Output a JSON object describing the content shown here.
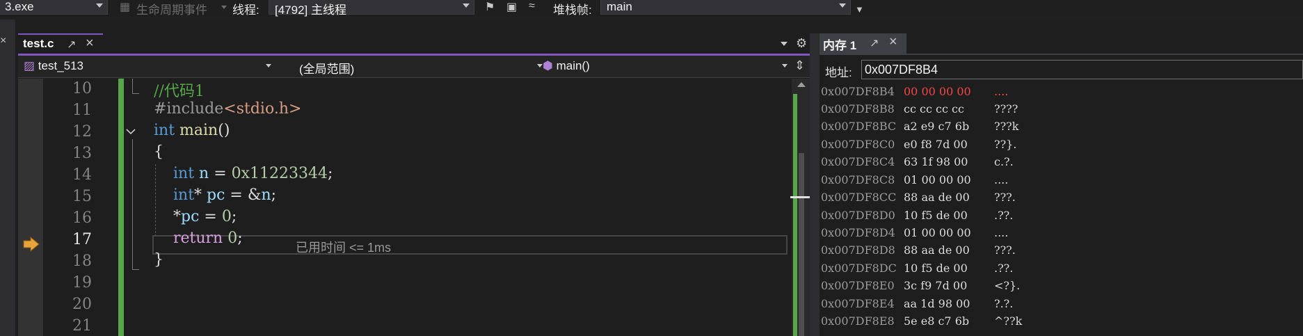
{
  "toolbar": {
    "process_value": "3.exe",
    "lifecycle_label": "生命周期事件",
    "thread_label": "线程:",
    "thread_value": "[4792] 主线程",
    "stackframe_label": "堆栈帧:",
    "stackframe_value": "main"
  },
  "editor": {
    "tab_title": "test.c",
    "nav": {
      "project": "test_513",
      "scope": "(全局范围)",
      "function": "main()"
    },
    "line_numbers": [
      "10",
      "11",
      "12",
      "13",
      "14",
      "15",
      "16",
      "17",
      "18",
      "19",
      "20",
      "21"
    ],
    "current_line": "17",
    "code": {
      "l10": "//代码1",
      "l11_pp": "#include",
      "l11_hdr": "<stdio.h>",
      "l12_kw": "int",
      "l12_fn": "main",
      "l12_paren": "()",
      "l13": "{",
      "l14_kw": "int",
      "l14_var": "n",
      "l14_op": " = ",
      "l14_num": "0x11223344",
      "l14_end": ";",
      "l15_kw": "int",
      "l15_star": "*",
      "l15_var": "pc",
      "l15_op": " = &",
      "l15_var2": "n",
      "l15_end": ";",
      "l16_star": "*",
      "l16_var": "pc",
      "l16_op": " = ",
      "l16_num": "0",
      "l16_end": ";",
      "l17_kw": "return",
      "l17_num": "0",
      "l17_end": ";",
      "l18": "}"
    },
    "perf_tip": "已用时间 <= 1ms"
  },
  "memory": {
    "tab_title": "内存 1",
    "address_label": "地址:",
    "address_value": "0x007DF8B4",
    "rows": [
      {
        "addr": "0x007DF8B4",
        "hex": "00 00 00 00",
        "ascii": "....",
        "changed": true
      },
      {
        "addr": "0x007DF8B8",
        "hex": "cc cc cc cc",
        "ascii": "????"
      },
      {
        "addr": "0x007DF8BC",
        "hex": "a2 e9 c7 6b",
        "ascii": "???k"
      },
      {
        "addr": "0x007DF8C0",
        "hex": "e0 f8 7d 00",
        "ascii": "??}."
      },
      {
        "addr": "0x007DF8C4",
        "hex": "63 1f 98 00",
        "ascii": "c.?."
      },
      {
        "addr": "0x007DF8C8",
        "hex": "01 00 00 00",
        "ascii": "...."
      },
      {
        "addr": "0x007DF8CC",
        "hex": "88 aa de 00",
        "ascii": "???."
      },
      {
        "addr": "0x007DF8D0",
        "hex": "10 f5 de 00",
        "ascii": ".??."
      },
      {
        "addr": "0x007DF8D4",
        "hex": "01 00 00 00",
        "ascii": "...."
      },
      {
        "addr": "0x007DF8D8",
        "hex": "88 aa de 00",
        "ascii": "???."
      },
      {
        "addr": "0x007DF8DC",
        "hex": "10 f5 de 00",
        "ascii": ".??."
      },
      {
        "addr": "0x007DF8E0",
        "hex": "3c f9 7d 00",
        "ascii": "<?}."
      },
      {
        "addr": "0x007DF8E4",
        "hex": "aa 1d 98 00",
        "ascii": "?.?."
      },
      {
        "addr": "0x007DF8E8",
        "hex": "5e e8 c7 6b",
        "ascii": "^??k"
      }
    ]
  },
  "colors": {
    "accent_tab": "#7e57c2",
    "change_bar": "#57a64a",
    "changed_bytes": "#f44747",
    "debug_arrow": "#e8a33b"
  }
}
